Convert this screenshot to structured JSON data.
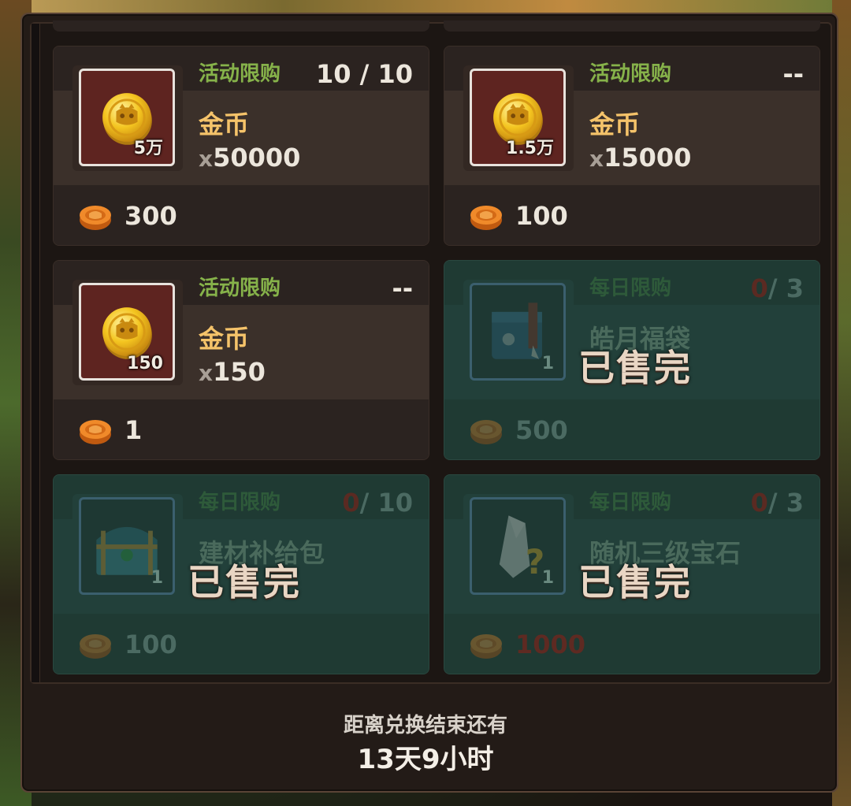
{
  "cards": [
    {
      "tag": "活动限购",
      "limit": "10 / 10",
      "name": "金币",
      "amount": "50000",
      "amount_prefix": "x",
      "thumb_qty": "5万",
      "price": "300",
      "item_icon": "gold-coin-icon",
      "sold_out": false
    },
    {
      "tag": "活动限购",
      "limit": "--",
      "name": "金币",
      "amount": "15000",
      "amount_prefix": "x",
      "thumb_qty": "1.5万",
      "price": "100",
      "item_icon": "gold-coin-icon",
      "sold_out": false
    },
    {
      "tag": "活动限购",
      "limit": "--",
      "name": "金币",
      "amount": "150",
      "amount_prefix": "x",
      "thumb_qty": "150",
      "price": "1",
      "item_icon": "gold-coin-icon",
      "sold_out": false
    },
    {
      "tag": "每日限购",
      "limit_used": "0",
      "limit_total": "/ 3",
      "name": "皓月福袋",
      "thumb_qty": "1",
      "price": "500",
      "item_icon": "lucky-bag-icon",
      "sold_out": true,
      "sold_out_label": "已售完"
    },
    {
      "tag": "每日限购",
      "limit_used": "0",
      "limit_total": "/ 10",
      "name": "建材补给包",
      "thumb_qty": "1",
      "price": "100",
      "item_icon": "treasure-chest-icon",
      "sold_out": true,
      "sold_out_label": "已售完"
    },
    {
      "tag": "每日限购",
      "limit_used": "0",
      "limit_total": "/ 3",
      "name": "随机三级宝石",
      "thumb_qty": "1",
      "price": "1000",
      "item_icon": "mystery-gem-icon",
      "sold_out": true,
      "sold_out_label": "已售完"
    }
  ],
  "currency_icon": "mooncake-icon",
  "timer": {
    "title": "距离兑换结束还有",
    "value": "13天9小时"
  },
  "colors": {
    "tag_green": "#86b24a",
    "name_gold": "#f5c36a",
    "sold_out_bg": "#1f3a33",
    "limit_red": "#c0392b"
  }
}
